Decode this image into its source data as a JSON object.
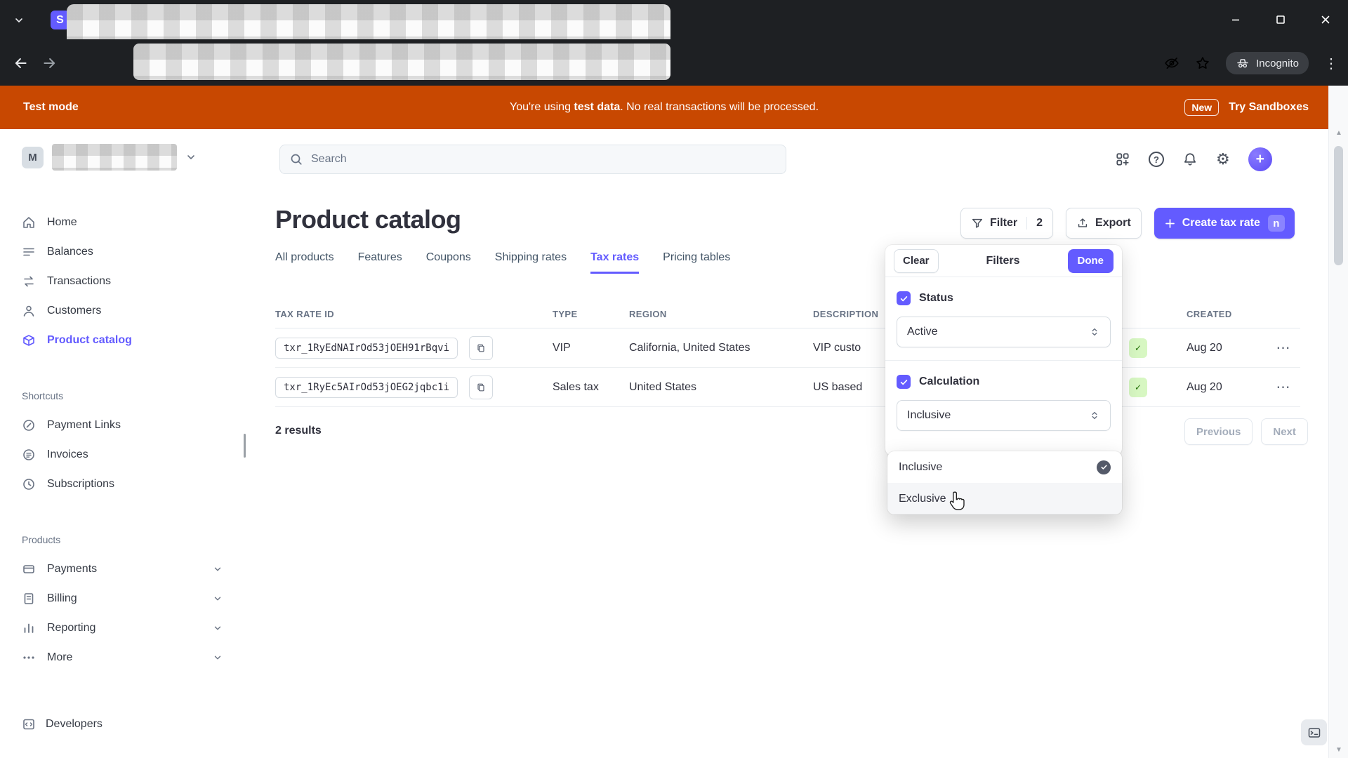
{
  "browser": {
    "favicon_letter": "S",
    "incognito_label": "Incognito"
  },
  "banner": {
    "mode_label": "Test mode",
    "msg_prefix": "You're using ",
    "msg_bold": "test data",
    "msg_suffix": ". No real transactions will be processed.",
    "new_badge": "New",
    "cta": "Try Sandboxes"
  },
  "sidebar": {
    "account_initial": "M",
    "items": [
      {
        "label": "Home"
      },
      {
        "label": "Balances"
      },
      {
        "label": "Transactions"
      },
      {
        "label": "Customers"
      },
      {
        "label": "Product catalog"
      }
    ],
    "shortcuts_label": "Shortcuts",
    "shortcuts": [
      {
        "label": "Payment Links"
      },
      {
        "label": "Invoices"
      },
      {
        "label": "Subscriptions"
      }
    ],
    "products_label": "Products",
    "products": [
      {
        "label": "Payments"
      },
      {
        "label": "Billing"
      },
      {
        "label": "Reporting"
      },
      {
        "label": "More"
      }
    ],
    "developers_label": "Developers"
  },
  "topbar": {
    "search_placeholder": "Search"
  },
  "page": {
    "title": "Product catalog",
    "tabs": [
      "All products",
      "Features",
      "Coupons",
      "Shipping rates",
      "Tax rates",
      "Pricing tables"
    ],
    "active_tab": "Tax rates",
    "filter_label": "Filter",
    "filter_count": "2",
    "export_label": "Export",
    "create_label": "Create tax rate",
    "create_shortcut": "n"
  },
  "table": {
    "headers": {
      "id": "TAX RATE ID",
      "type": "TYPE",
      "region": "REGION",
      "description": "DESCRIPTION",
      "created": "CREATED"
    },
    "rows": [
      {
        "id": "txr_1RyEdNAIrOd53jOEH91rBqvi",
        "type": "VIP",
        "region": "California, United States",
        "description": "VIP custo",
        "created": "Aug 20"
      },
      {
        "id": "txr_1RyEc5AIrOd53jOEG2jqbc1i",
        "type": "Sales tax",
        "region": "United States",
        "description": "US based",
        "created": "Aug 20"
      }
    ],
    "results_text": "2 results",
    "previous_label": "Previous",
    "next_label": "Next"
  },
  "filters": {
    "clear_label": "Clear",
    "title": "Filters",
    "done_label": "Done",
    "sections": [
      {
        "label": "Status",
        "value": "Active"
      },
      {
        "label": "Calculation",
        "value": "Inclusive"
      }
    ],
    "options": [
      {
        "label": "Inclusive",
        "selected": true
      },
      {
        "label": "Exclusive",
        "selected": false
      }
    ]
  },
  "icons": {
    "help": "?",
    "gear": "⚙",
    "plus": "+",
    "overflow": "⋯",
    "menu": "⋮",
    "up": "▲",
    "down": "▼"
  },
  "colors": {
    "accent": "#635BFF",
    "banner_orange": "#C84801",
    "badge_green_bg": "#D7F7C2"
  }
}
